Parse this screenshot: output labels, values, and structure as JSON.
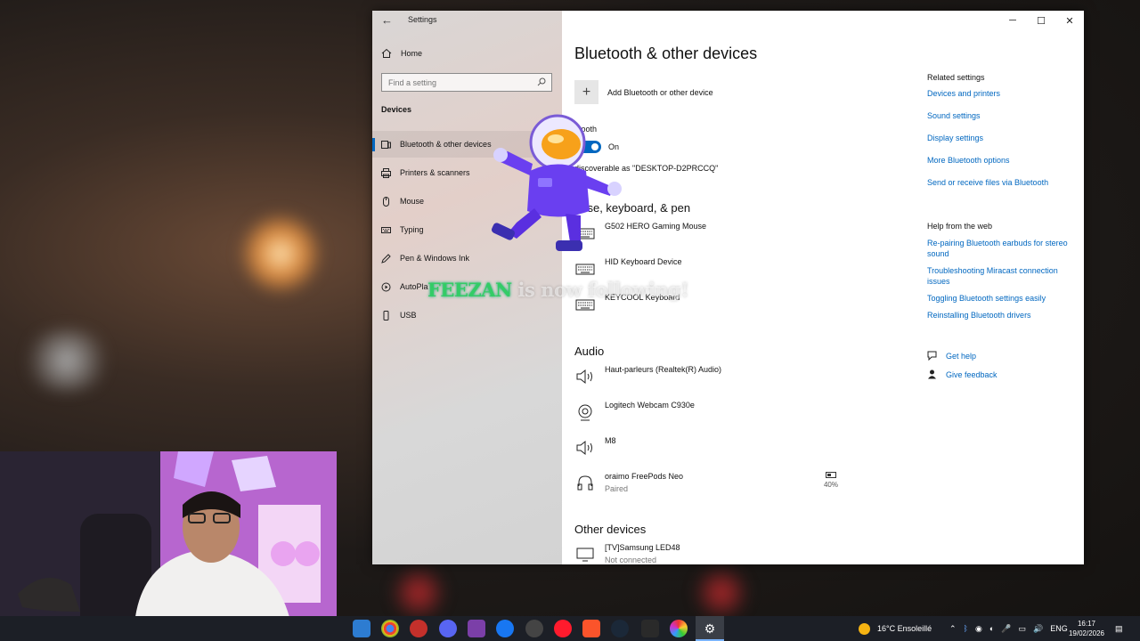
{
  "window": {
    "app_title": "Settings",
    "home_label": "Home",
    "search_placeholder": "Find a setting",
    "section_label": "Devices",
    "controls": {
      "minimize": "─",
      "maximize": "☐",
      "close": "✕"
    }
  },
  "sidebar": {
    "items": [
      {
        "label": "Bluetooth & other devices",
        "icon": "bluetooth-devices-icon",
        "active": true
      },
      {
        "label": "Printers & scanners",
        "icon": "printer-icon"
      },
      {
        "label": "Mouse",
        "icon": "mouse-icon"
      },
      {
        "label": "Typing",
        "icon": "keyboard-icon"
      },
      {
        "label": "Pen & Windows Ink",
        "icon": "pen-icon"
      },
      {
        "label": "AutoPla",
        "icon": "autoplay-icon"
      },
      {
        "label": "USB",
        "icon": "usb-icon"
      }
    ]
  },
  "main": {
    "title": "Bluetooth & other devices",
    "add_device_label": "Add Bluetooth or other device",
    "bluetooth_label": "etooth",
    "bluetooth_state": "On",
    "discoverable_text": "discoverable as \"DESKTOP-D2PRCCQ\"",
    "groups": {
      "mouse_keyboard_pen": {
        "title": "ouse, keyboard, & pen",
        "devices": [
          {
            "name": "G502 HERO Gaming Mouse",
            "icon": "keyboard-icon"
          },
          {
            "name": "HID Keyboard Device",
            "icon": "keyboard-icon"
          },
          {
            "name": "KEYCOOL Keyboard",
            "icon": "keyboard-icon"
          }
        ]
      },
      "audio": {
        "title": "Audio",
        "devices": [
          {
            "name": "Haut-parleurs (Realtek(R) Audio)",
            "icon": "speaker-icon"
          },
          {
            "name": "Logitech Webcam C930e",
            "icon": "webcam-icon"
          },
          {
            "name": "M8",
            "icon": "speaker-icon"
          },
          {
            "name": "oraimo FreePods Neo",
            "status": "Paired",
            "battery": "40%",
            "icon": "headset-icon"
          }
        ]
      },
      "other": {
        "title": "Other devices",
        "devices": [
          {
            "name": "[TV]Samsung LED48",
            "status": "Not connected",
            "icon": "monitor-icon"
          }
        ]
      }
    }
  },
  "related_settings": {
    "title": "Related settings",
    "links": [
      "Devices and printers",
      "Sound settings",
      "Display settings",
      "More Bluetooth options",
      "Send or receive files via Bluetooth"
    ]
  },
  "help_from_web": {
    "title": "Help from the web",
    "links": [
      "Re-pairing Bluetooth earbuds for stereo sound",
      "Troubleshooting Miracast connection issues",
      "Toggling Bluetooth settings easily",
      "Reinstalling Bluetooth drivers"
    ],
    "get_help": "Get help",
    "give_feedback": "Give feedback"
  },
  "overlay": {
    "follower_name": "FEEZAN",
    "follow_text": " is now following!"
  },
  "taskbar": {
    "weather": "16°C  Ensoleillé",
    "language": "ENG",
    "time": "16:17",
    "date": "19/02/2026"
  },
  "colors": {
    "accent": "#0067c0",
    "taskbar": "#1c1f26",
    "follow_name": "#33cc66"
  }
}
